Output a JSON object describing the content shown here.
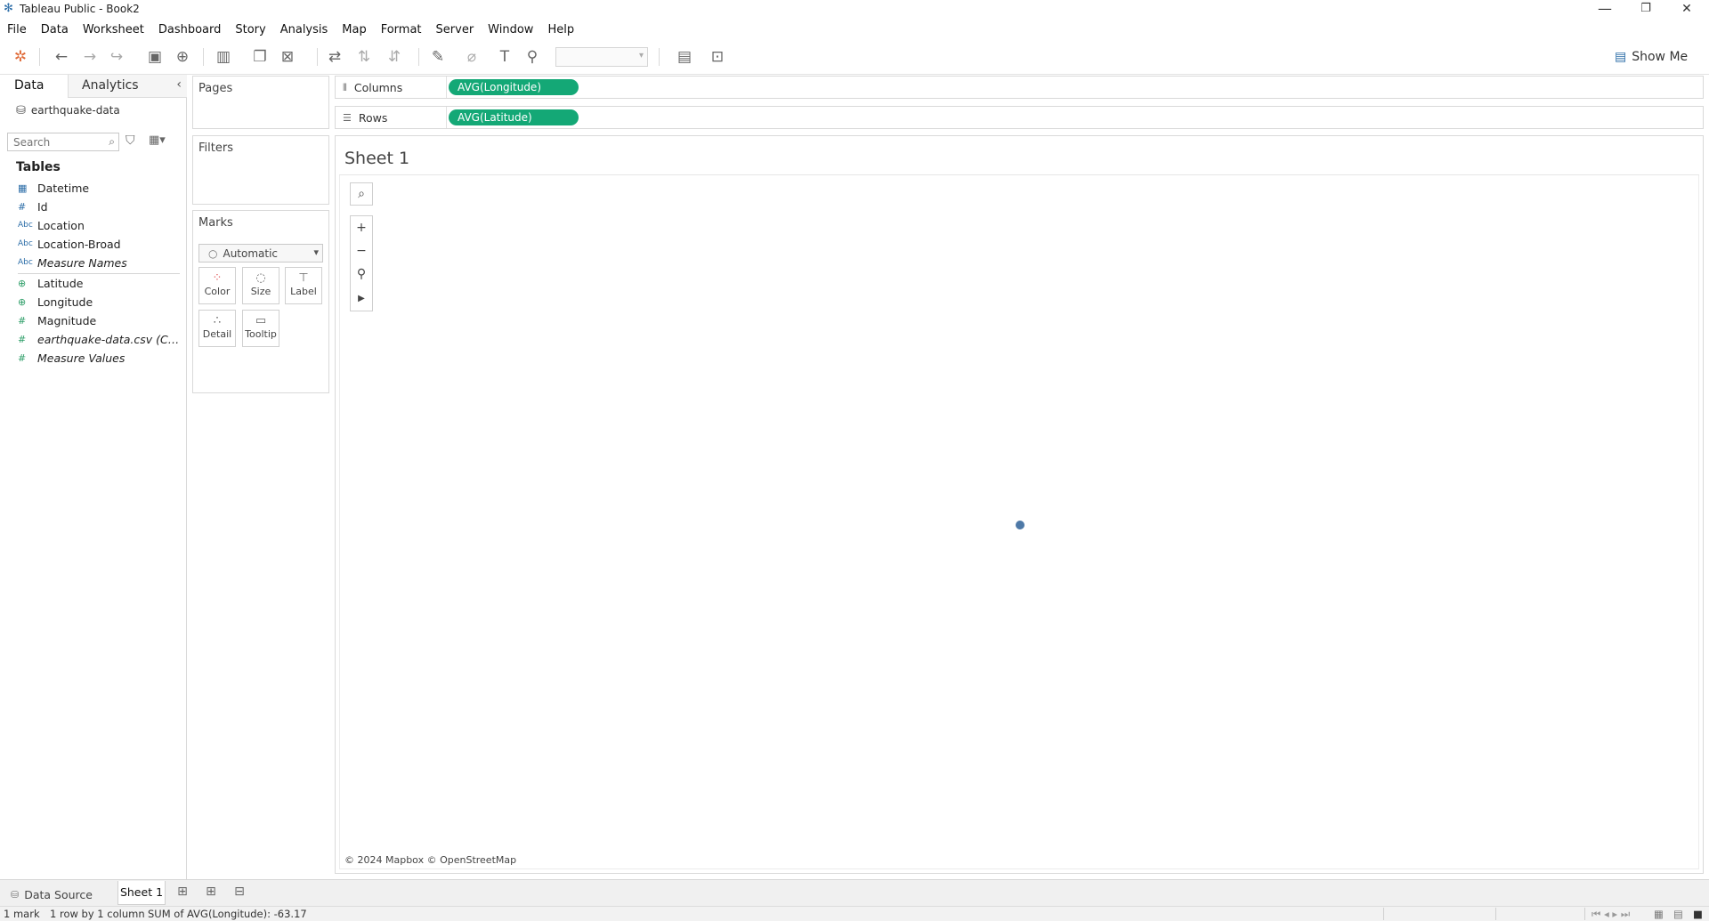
{
  "window": {
    "title": "Tableau Public - Book2",
    "minimize": "—",
    "restore": "❐",
    "close": "✕"
  },
  "menu": [
    "File",
    "Data",
    "Worksheet",
    "Dashboard",
    "Story",
    "Analysis",
    "Map",
    "Format",
    "Server",
    "Window",
    "Help"
  ],
  "toolbar": {
    "show_me": "Show Me"
  },
  "data_pane": {
    "tab_data": "Data",
    "tab_analytics": "Analytics",
    "datasource": "earthquake-data",
    "search_placeholder": "Search",
    "tables_heading": "Tables",
    "fields": [
      {
        "label": "Datetime",
        "icon": "calendar-icon"
      },
      {
        "label": "Id",
        "icon": "number-icon"
      },
      {
        "label": "Location",
        "icon": "string-icon"
      },
      {
        "label": "Location-Broad",
        "icon": "string-icon"
      },
      {
        "label": "Measure Names",
        "icon": "string-icon"
      },
      {
        "label": "Latitude",
        "icon": "globe-icon"
      },
      {
        "label": "Longitude",
        "icon": "globe-icon"
      },
      {
        "label": "Magnitude",
        "icon": "number-icon"
      },
      {
        "label": "earthquake-data.csv (Cou...",
        "icon": "number-icon"
      },
      {
        "label": "Measure Values",
        "icon": "number-icon"
      }
    ]
  },
  "cards": {
    "pages": "Pages",
    "filters": "Filters",
    "marks": "Marks",
    "marks_type": "Automatic",
    "mark_buttons": {
      "color": "Color",
      "size": "Size",
      "label": "Label",
      "detail": "Detail",
      "tooltip": "Tooltip"
    }
  },
  "shelves": {
    "columns_label": "Columns",
    "columns_pill": "AVG(Longitude)",
    "rows_label": "Rows",
    "rows_pill": "AVG(Latitude)"
  },
  "view": {
    "sheet_title": "Sheet 1",
    "attribution": "© 2024 Mapbox © OpenStreetMap"
  },
  "sheet_tabs": {
    "data_source": "Data Source",
    "sheet1": "Sheet 1"
  },
  "status": {
    "marks": "1 mark",
    "dims": "1 row by 1 column",
    "sum": "SUM of AVG(Longitude): -63.17"
  }
}
